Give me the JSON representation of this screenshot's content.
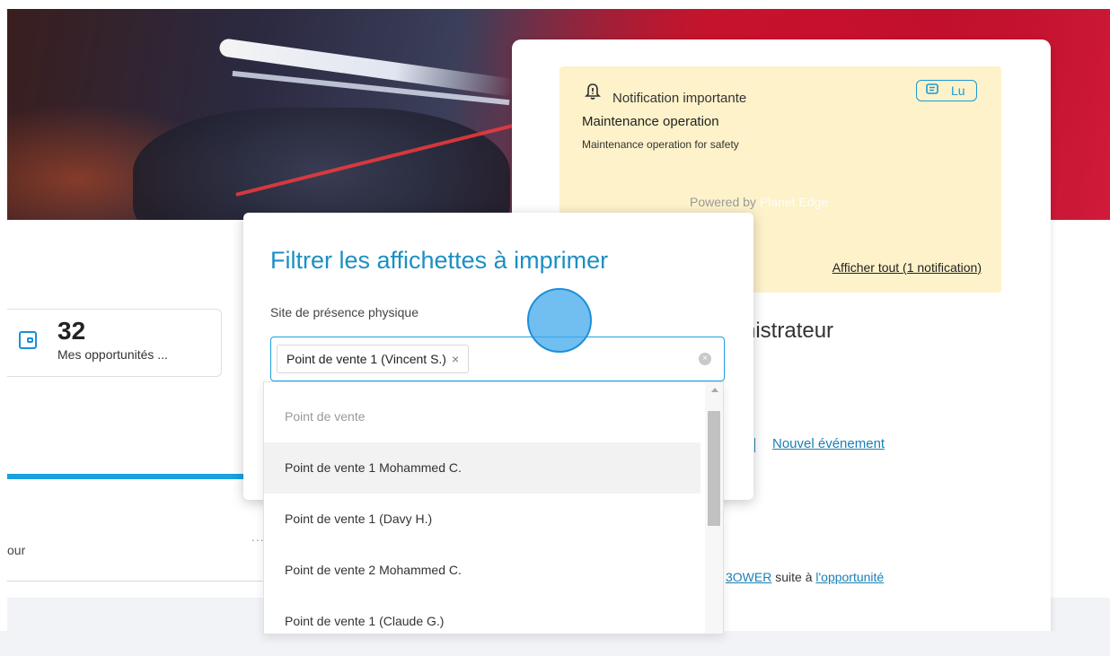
{
  "notification": {
    "title": "Notification importante",
    "read_label": "Lu",
    "subject": "Maintenance operation",
    "description": "Maintenance operation for safety",
    "powered_by": "Powered by",
    "brand": "Planet Edge",
    "show_all": "Afficher tout (1 notification)"
  },
  "kpi": {
    "value": "32",
    "label": "Mes opportunités ..."
  },
  "background": {
    "role_title": "nistrateur",
    "new_event": "Nouvel événement",
    "history_link1": "3OWER",
    "history_middle": " suite à ",
    "history_link2": "l'opportunité",
    "tab_partial": "our",
    "dots": "..."
  },
  "modal": {
    "title": "Filtrer les affichettes à imprimer",
    "field_label": "Site de présence physique",
    "selected_chip": "Point de vente 1 (Vincent S.)",
    "chip_remove": "×",
    "clear_icon": "×"
  },
  "dropdown": {
    "options": [
      {
        "label": "Point de vente",
        "type": "group"
      },
      {
        "label": "Point de vente 1 Mohammed C.",
        "type": "option",
        "highlighted": true
      },
      {
        "label": "Point de vente 1 (Davy H.)",
        "type": "option"
      },
      {
        "label": "Point de vente 2 Mohammed C.",
        "type": "option"
      },
      {
        "label": "Point de vente 1 (Claude G.)",
        "type": "option"
      }
    ]
  },
  "icons": {
    "bell": "bell-alert-icon",
    "read": "message-read-icon",
    "wallet": "wallet-icon",
    "clear": "clear-circle-icon"
  },
  "colors": {
    "accent": "#1aa1e0",
    "title_blue": "#1c8fc4",
    "notification_bg": "#fdf2c9",
    "cursor": "#40aaeb"
  }
}
